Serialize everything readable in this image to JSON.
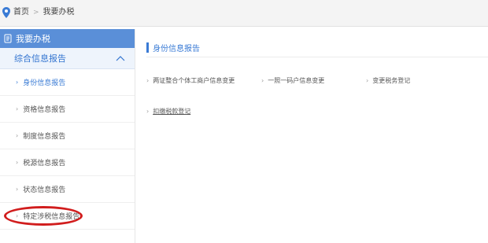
{
  "breadcrumb": {
    "home": "首页",
    "separator": ">",
    "current": "我要办税"
  },
  "sidebar": {
    "header": "我要办税",
    "group": "综合信息报告",
    "items": [
      {
        "label": "身份信息报告",
        "active": true
      },
      {
        "label": "资格信息报告",
        "active": false
      },
      {
        "label": "制度信息报告",
        "active": false
      },
      {
        "label": "税源信息报告",
        "active": false
      },
      {
        "label": "状态信息报告",
        "active": false
      },
      {
        "label": "特定涉税信息报告",
        "active": false,
        "highlighted": true
      }
    ]
  },
  "main": {
    "title": "身份信息报告",
    "links": [
      {
        "label": "两证整合个体工商户信息变更"
      },
      {
        "label": "一照一码户信息变更"
      },
      {
        "label": "变更税务登记"
      },
      {
        "label": "扣缴税款登记"
      }
    ]
  },
  "colors": {
    "accent": "#3a7bd5",
    "sidebar_header": "#5a8fd8",
    "highlight_oval": "#d11d1d"
  }
}
